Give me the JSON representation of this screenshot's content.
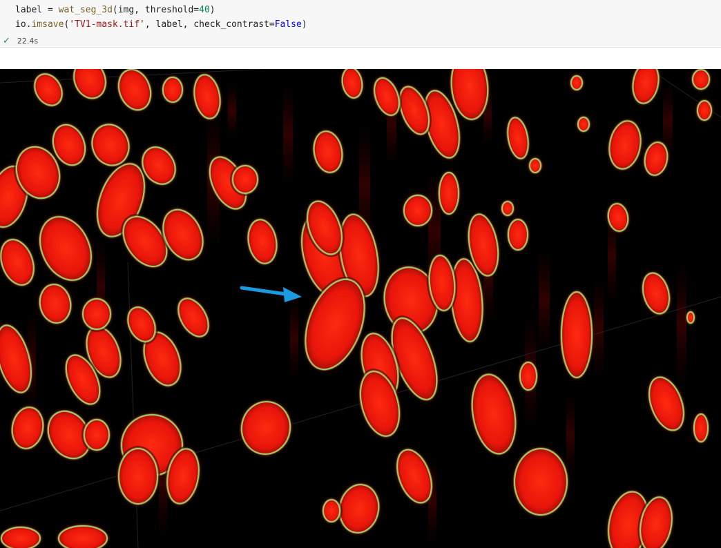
{
  "cell": {
    "code_lines": [
      {
        "parts": [
          {
            "t": "label = ",
            "c": ""
          },
          {
            "t": "wat_seg_3d",
            "c": "fn"
          },
          {
            "t": "(img, threshold=",
            "c": ""
          },
          {
            "t": "40",
            "c": "num"
          },
          {
            "t": ")",
            "c": ""
          }
        ]
      },
      {
        "parts": [
          {
            "t": "io.",
            "c": ""
          },
          {
            "t": "imsave",
            "c": "fn"
          },
          {
            "t": "(",
            "c": ""
          },
          {
            "t": "'TV1-mask.tif'",
            "c": "str"
          },
          {
            "t": ", label, check_contrast=",
            "c": ""
          },
          {
            "t": "False",
            "c": "kw"
          },
          {
            "t": ")",
            "c": ""
          }
        ]
      }
    ],
    "status_icon": "check-icon",
    "exec_time": "22.4s"
  },
  "viewer": {
    "background": "#000000",
    "cell_fill": "#ff1a0a",
    "outline_color": "#b7e07a",
    "arrow_color": "#1a9be0",
    "annotation_icon": "arrow-icon"
  }
}
